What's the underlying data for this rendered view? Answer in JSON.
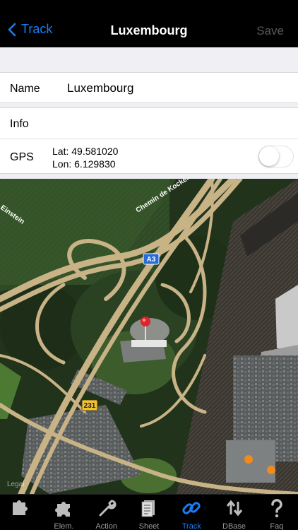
{
  "nav": {
    "back_label": "Track",
    "title": "Luxembourg",
    "save_label": "Save"
  },
  "form": {
    "name_label": "Name",
    "name_value": "Luxembourg",
    "info_label": "Info",
    "gps_label": "GPS",
    "lat": "Lat: 49.581020",
    "lon": "Lon: 6.129830",
    "gps_toggle_on": false
  },
  "map": {
    "street_1": "Chemin de Kockelsche",
    "street_2": "Einstein",
    "route_a3": "A3",
    "route_231": "231",
    "legal": "Legal"
  },
  "tabs": [
    {
      "label": "",
      "icon": "puzzle-piece-icon",
      "active": false
    },
    {
      "label": "Elem.",
      "icon": "puzzle-icon",
      "active": false
    },
    {
      "label": "Action",
      "icon": "wrench-icon",
      "active": false
    },
    {
      "label": "Sheet",
      "icon": "sheet-icon",
      "active": false
    },
    {
      "label": "Track",
      "icon": "chain-link-icon",
      "active": true
    },
    {
      "label": "DBase",
      "icon": "sort-arrows-icon",
      "active": false
    },
    {
      "label": "Faq",
      "icon": "question-icon",
      "active": false
    }
  ],
  "colors": {
    "accent": "#1a7cf5",
    "pin": "#e0242b",
    "road": "#c8b386",
    "shield_a3": "#2a6bd6",
    "shield_231": "#f2c12e"
  }
}
